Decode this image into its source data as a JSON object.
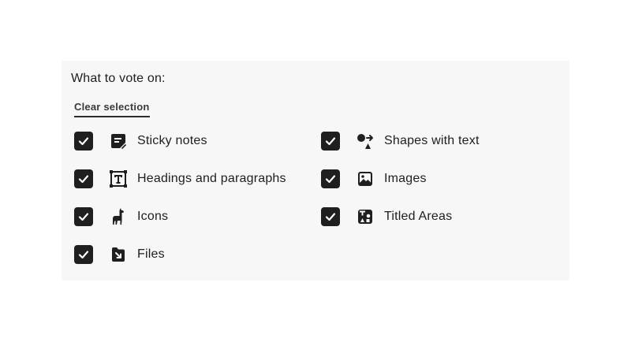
{
  "header": {
    "title": "What to vote on:",
    "clear_label": "Clear selection"
  },
  "options": [
    {
      "label": "Sticky notes",
      "icon": "sticky-note-icon",
      "checked": true
    },
    {
      "label": "Shapes with text",
      "icon": "shapes-icon",
      "checked": true
    },
    {
      "label": "Headings and paragraphs",
      "icon": "text-heading-icon",
      "checked": true
    },
    {
      "label": "Images",
      "icon": "image-icon",
      "checked": true
    },
    {
      "label": "Icons",
      "icon": "llama-icon",
      "checked": true
    },
    {
      "label": "Titled Areas",
      "icon": "titled-area-icon",
      "checked": true
    },
    {
      "label": "Files",
      "icon": "file-icon",
      "checked": true
    }
  ],
  "colors": {
    "panel_bg": "#f7f7f7",
    "checkbox_bg": "#1f1f1f",
    "text": "#1e1e1e"
  }
}
